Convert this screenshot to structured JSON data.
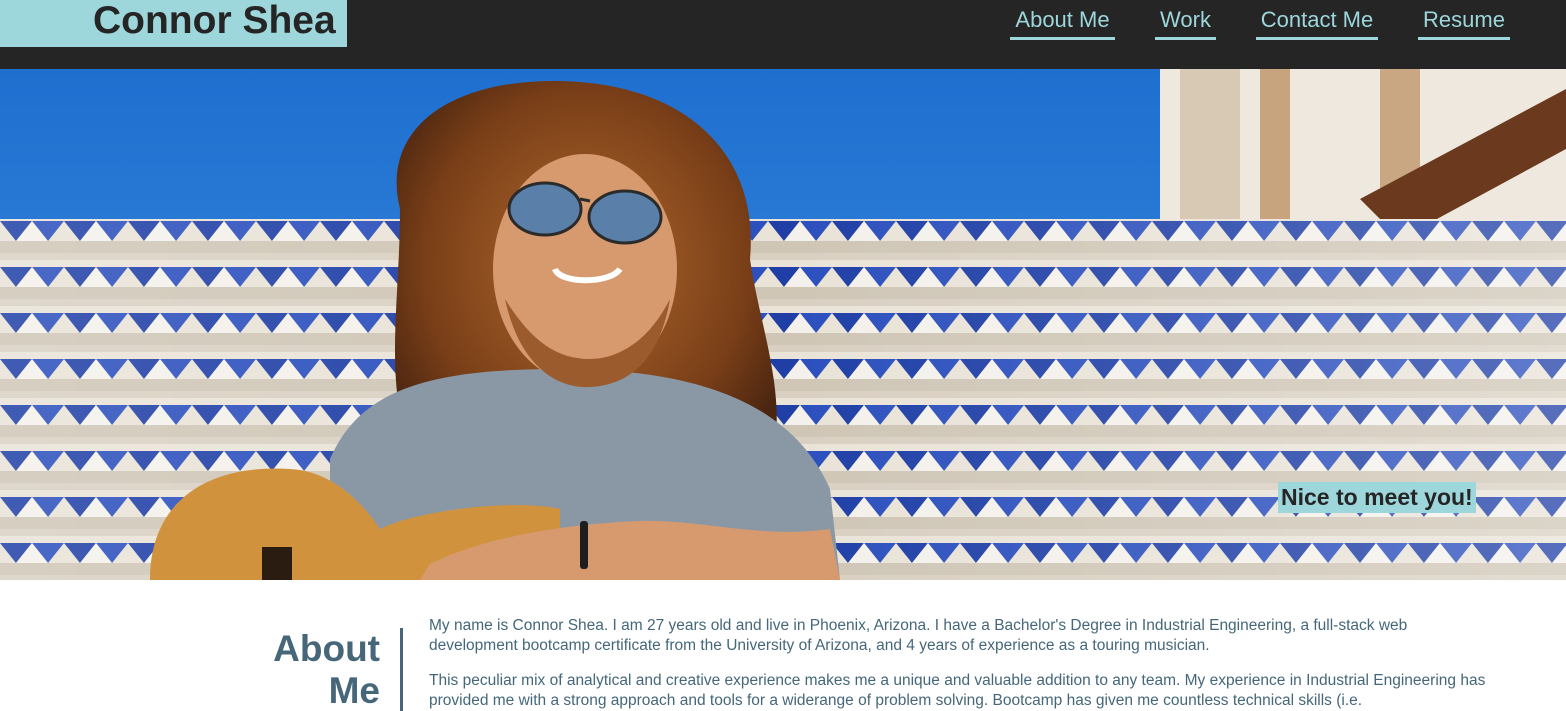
{
  "site": {
    "name": "Connor Shea"
  },
  "nav": {
    "items": [
      {
        "label": "About Me"
      },
      {
        "label": "Work"
      },
      {
        "label": "Contact Me"
      },
      {
        "label": "Resume"
      }
    ]
  },
  "hero": {
    "caption": "Nice to meet you!",
    "photo_alt": "Portrait photo of Connor Shea holding a guitar on tiled steps"
  },
  "about": {
    "heading_line1": "About",
    "heading_line2": "Me",
    "paragraphs": [
      "My name is Connor Shea. I am 27 years old and live in Phoenix, Arizona. I have a Bachelor's Degree in Industrial Engineering, a full-stack web development bootcamp certificate from the University of Arizona, and 4 years of experience as a touring musician.",
      "This peculiar mix of analytical and creative experience makes me a unique and valuable addition to any team. My experience in Industrial Engineering has provided me with a strong approach and tools for a widerange of problem solving. Bootcamp has given me countless technical skills (i.e."
    ]
  },
  "colors": {
    "header_bg": "#252525",
    "accent": "#9dd6db",
    "text": "#456779"
  }
}
